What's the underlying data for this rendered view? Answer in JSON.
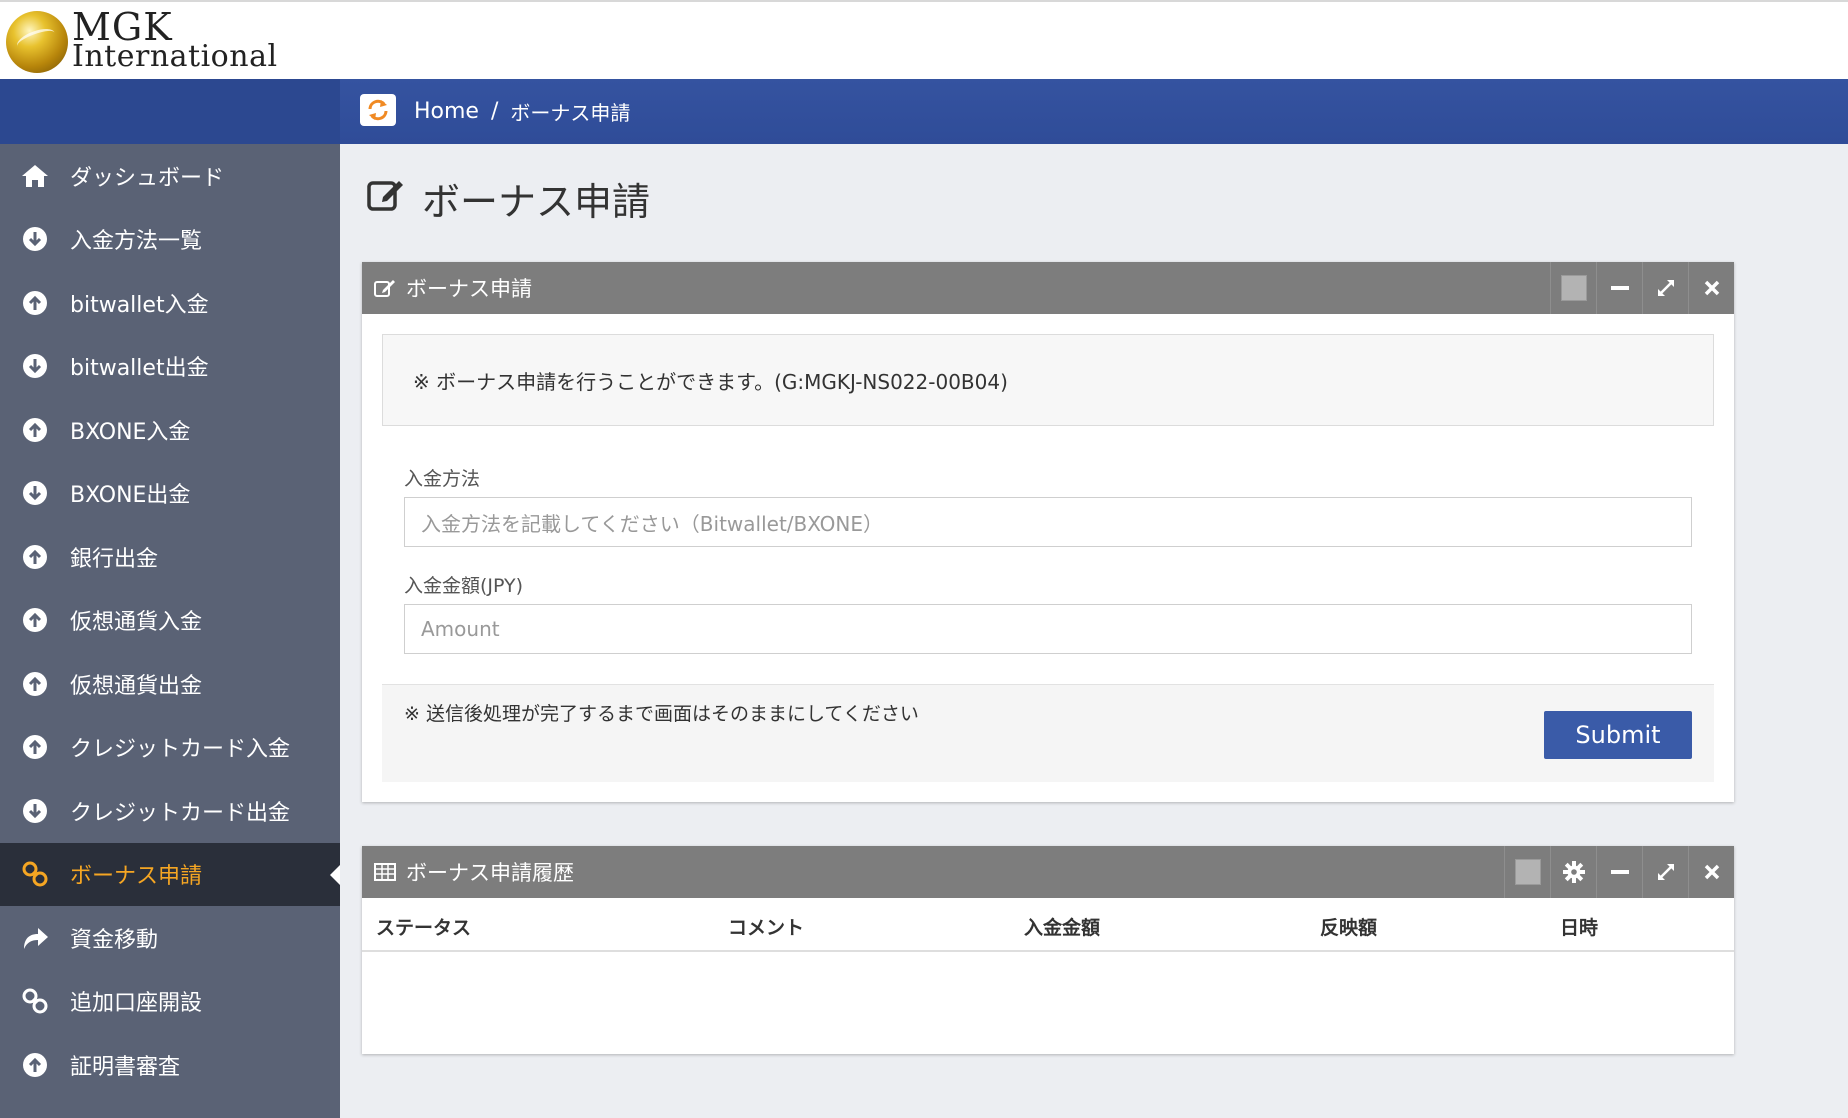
{
  "brand": {
    "line1": "MGK",
    "line2": "International"
  },
  "breadcrumb": {
    "home": "Home",
    "separator": "/",
    "current": "ボーナス申請"
  },
  "sidebar": {
    "items": [
      {
        "label": "ダッシュボード",
        "icon": "home-icon"
      },
      {
        "label": "入金方法一覧",
        "icon": "arrow-down-circle-icon"
      },
      {
        "label": "bitwallet入金",
        "icon": "arrow-up-circle-icon"
      },
      {
        "label": "bitwallet出金",
        "icon": "arrow-down-circle-icon"
      },
      {
        "label": "BXONE入金",
        "icon": "arrow-up-circle-icon"
      },
      {
        "label": "BXONE出金",
        "icon": "arrow-down-circle-icon"
      },
      {
        "label": "銀行出金",
        "icon": "arrow-up-circle-icon"
      },
      {
        "label": "仮想通貨入金",
        "icon": "arrow-up-circle-icon"
      },
      {
        "label": "仮想通貨出金",
        "icon": "arrow-up-circle-icon"
      },
      {
        "label": "クレジットカード入金",
        "icon": "arrow-up-circle-icon"
      },
      {
        "label": "クレジットカード出金",
        "icon": "arrow-down-circle-icon"
      },
      {
        "label": "ボーナス申請",
        "icon": "link-icon",
        "active": true
      },
      {
        "label": "資金移動",
        "icon": "share-arrow-icon"
      },
      {
        "label": "追加口座開設",
        "icon": "link-icon"
      },
      {
        "label": "証明書審査",
        "icon": "arrow-up-circle-icon"
      }
    ]
  },
  "page": {
    "title": "ボーナス申請"
  },
  "form_panel": {
    "title": "ボーナス申請",
    "notice": "※ ボーナス申請を行うことができます。(G:MGKJ-NS022-00B04)",
    "deposit_method": {
      "label": "入金方法",
      "placeholder": "入金方法を記載してください（Bitwallet/BXONE）"
    },
    "deposit_amount": {
      "label": "入金金額(JPY)",
      "placeholder": "Amount"
    },
    "footer_note": "※ 送信後処理が完了するまで画面はそのままにしてください",
    "submit_label": "Submit"
  },
  "history_panel": {
    "title": "ボーナス申請履歴",
    "columns": [
      "ステータス",
      "コメント",
      "入金金額",
      "反映額",
      "日時"
    ]
  },
  "colors": {
    "header_blue": "#2f4c98",
    "sidebar": "#5a6275",
    "active_item": "#f5a623",
    "submit": "#3a5ba8"
  }
}
